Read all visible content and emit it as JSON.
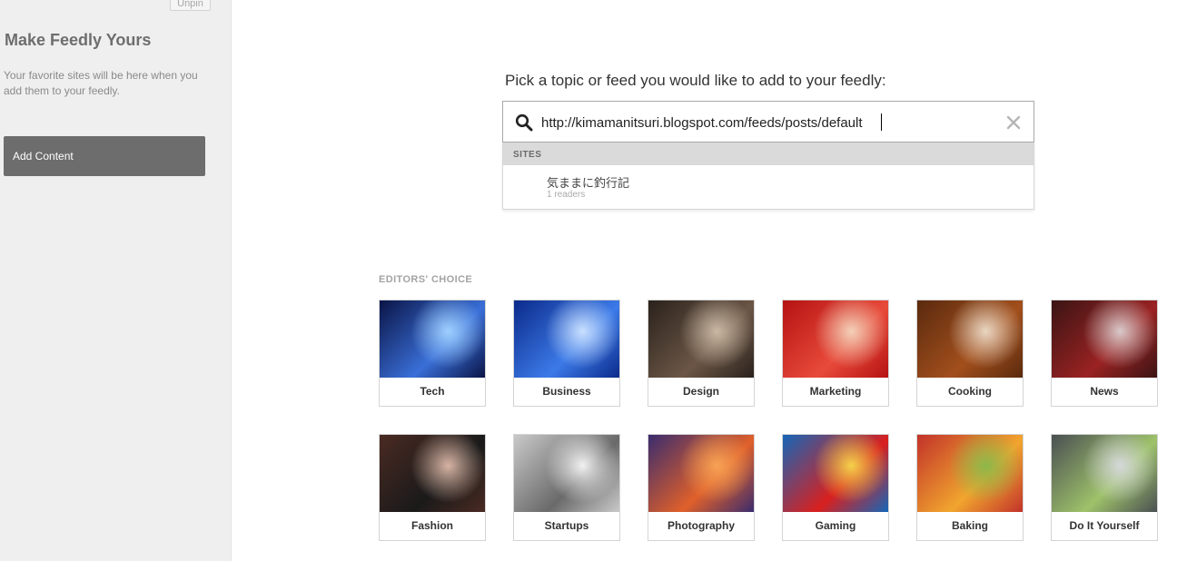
{
  "sidebar": {
    "unpin_label": "Unpin",
    "title": "Make Feedly Yours",
    "description": "Your favorite sites will be here when you add them to your feedly.",
    "add_button": "Add Content"
  },
  "search": {
    "prompt": "Pick a topic or feed you would like to add to your feedly:",
    "value": "http://kimamanitsuri.blogspot.com/feeds/posts/default",
    "search_icon": "search-icon",
    "clear_icon": "close-icon"
  },
  "results": {
    "section_label": "SITES",
    "items": [
      {
        "name": "気ままに釣行記",
        "readers": "1 readers"
      }
    ]
  },
  "editors_choice": {
    "label": "EDITORS' CHOICE",
    "topics": [
      {
        "label": "Tech",
        "palette": [
          "#0a1446",
          "#3a6fd8",
          "#9fd0ff"
        ]
      },
      {
        "label": "Business",
        "palette": [
          "#0b2a8a",
          "#3c7ae8",
          "#c9e0ff"
        ]
      },
      {
        "label": "Design",
        "palette": [
          "#2a221c",
          "#6b5646",
          "#c9b8a4"
        ]
      },
      {
        "label": "Marketing",
        "palette": [
          "#b51212",
          "#e84a3a",
          "#f3d0b8"
        ]
      },
      {
        "label": "Cooking",
        "palette": [
          "#5a2a0e",
          "#a24f1c",
          "#e9d6c2"
        ]
      },
      {
        "label": "News",
        "palette": [
          "#3b1414",
          "#9a2222",
          "#d9c9c9"
        ]
      },
      {
        "label": "Fashion",
        "palette": [
          "#4a2a22",
          "#1a1a1a",
          "#d7b4a4"
        ]
      },
      {
        "label": "Startups",
        "palette": [
          "#c9c9c9",
          "#6a6a6a",
          "#f1f1f1"
        ]
      },
      {
        "label": "Photography",
        "palette": [
          "#3a2c6e",
          "#e0602a",
          "#f7a255"
        ]
      },
      {
        "label": "Gaming",
        "palette": [
          "#1566b8",
          "#d9201e",
          "#f5d14a"
        ]
      },
      {
        "label": "Baking",
        "palette": [
          "#c2322a",
          "#f1a52e",
          "#8db84a"
        ]
      },
      {
        "label": "Do It Yourself",
        "palette": [
          "#4a4f52",
          "#9ec26a",
          "#d5d8da"
        ]
      }
    ]
  }
}
